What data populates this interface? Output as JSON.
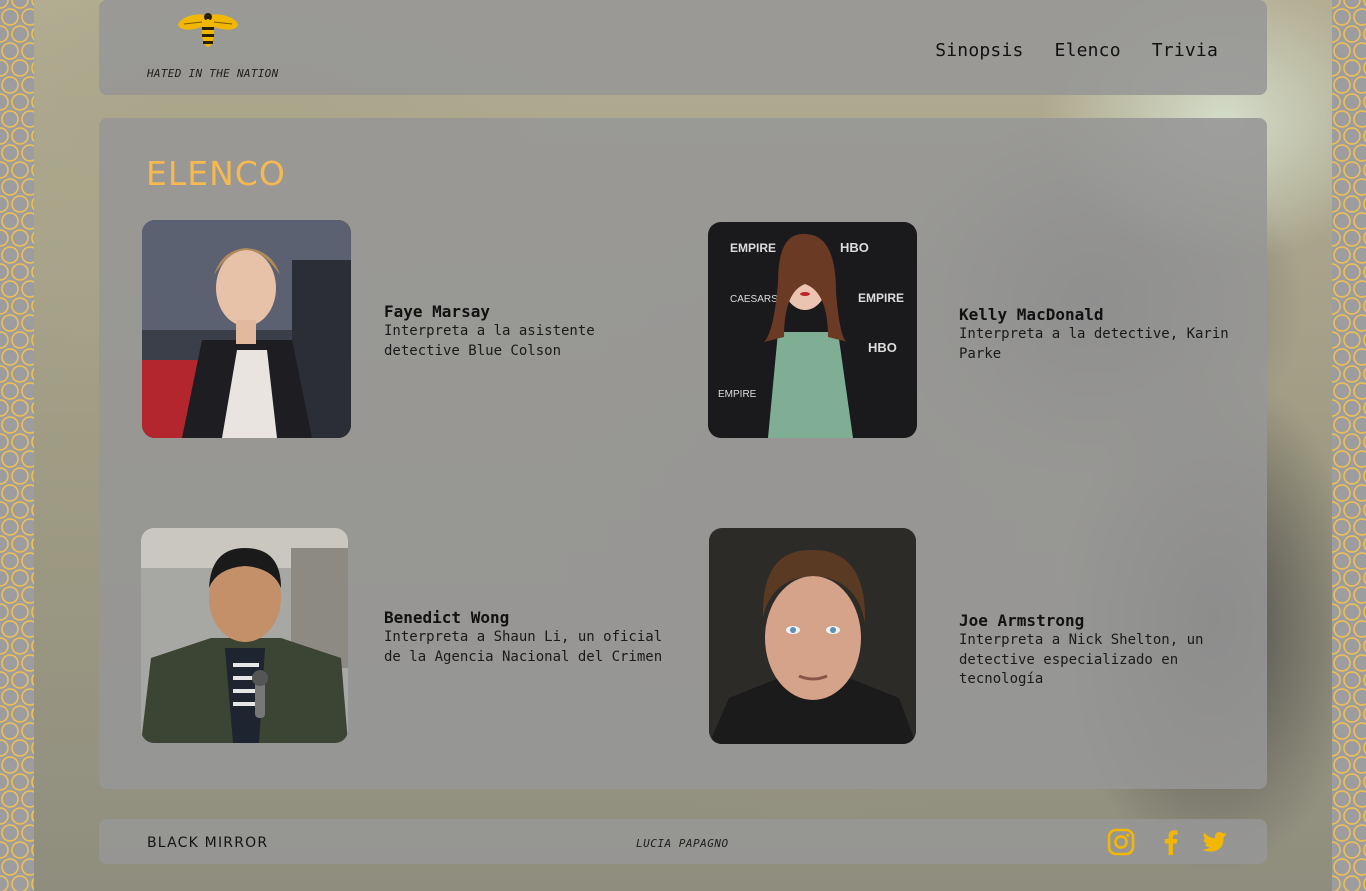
{
  "site": {
    "logo_text": "HATED IN THE NATION"
  },
  "nav": {
    "items": [
      "Sinopsis",
      "Elenco",
      "Trivia"
    ]
  },
  "section": {
    "title": "ELENCO"
  },
  "cast": [
    {
      "name": "Faye Marsay",
      "role": "Interpreta a la asistente detective Blue Colson"
    },
    {
      "name": "Kelly MacDonald",
      "role": "Interpreta a la detective, Karin Parke"
    },
    {
      "name": "Benedict Wong",
      "role": "Interpreta a Shaun Li, un oficial de la Agencia Nacional del Crimen"
    },
    {
      "name": "Joe Armstrong",
      "role": "Interpreta a Nick Shelton, un detective especializado en tecnología"
    }
  ],
  "footer": {
    "brand": "BLACK MIRROR",
    "credit": "LUCIA PAPAGNO",
    "social": [
      "instagram-icon",
      "facebook-icon",
      "twitter-icon"
    ]
  },
  "colors": {
    "accent": "#f6b94f",
    "social": "#f2b705",
    "panel": "#969696"
  }
}
